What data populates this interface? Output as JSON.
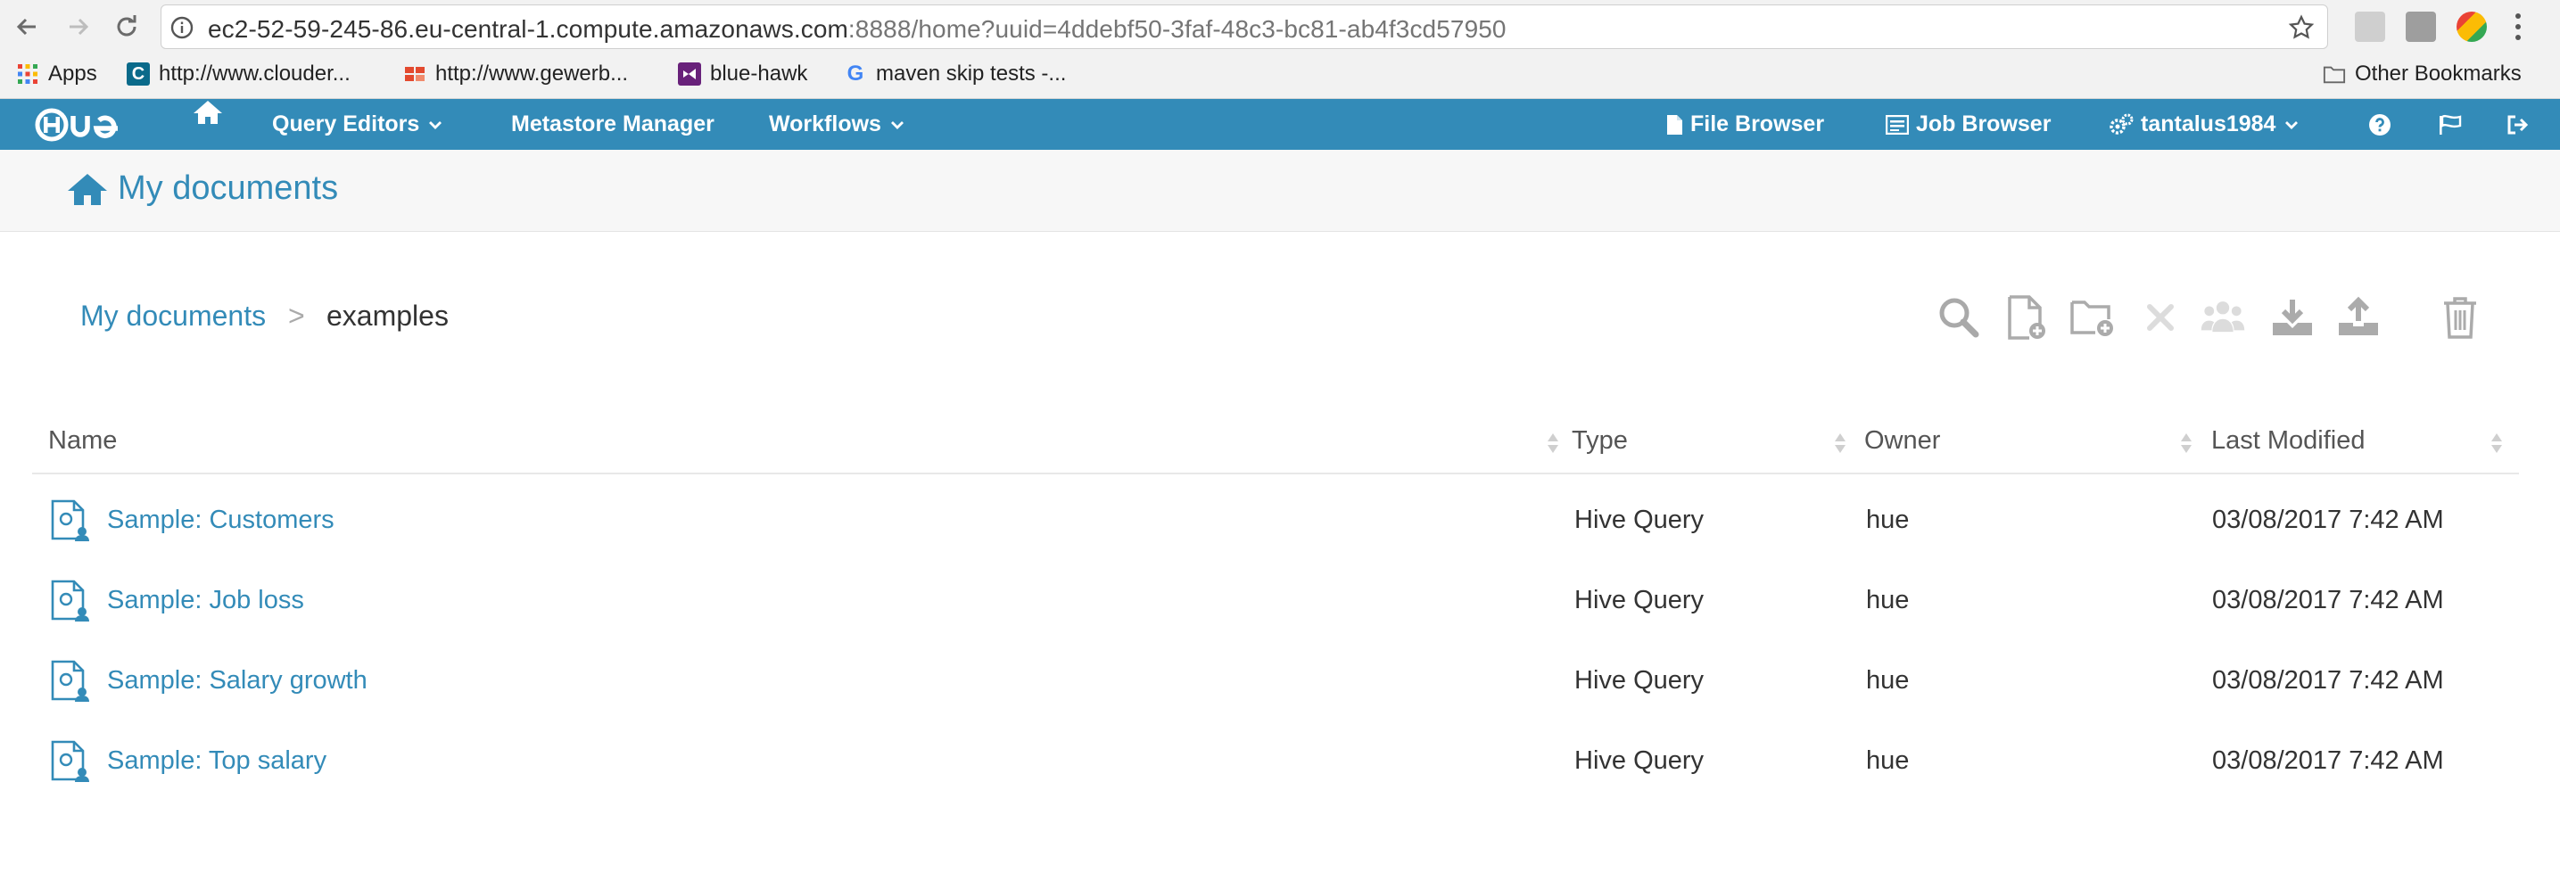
{
  "browser": {
    "url_host": "ec2-52-59-245-86.eu-central-1.compute.amazonaws.com",
    "url_rest": ":8888/home?uuid=4ddebf50-3faf-48c3-bc81-ab4f3cd57950",
    "bookmarks": [
      {
        "label": "Apps",
        "icon": "apps-grid-icon"
      },
      {
        "label": "http://www.clouder...",
        "icon": "cloudera-icon"
      },
      {
        "label": "http://www.gewerb...",
        "icon": "gewerbe-icon"
      },
      {
        "label": "blue-hawk",
        "icon": "visual-studio-icon"
      },
      {
        "label": "maven skip tests -...",
        "icon": "google-icon"
      }
    ],
    "other_bookmarks": "Other Bookmarks"
  },
  "hue_nav": {
    "logo": "HUE",
    "query_editors": "Query Editors",
    "metastore": "Metastore Manager",
    "workflows": "Workflows",
    "file_browser": "File Browser",
    "job_browser": "Job Browser",
    "user": "tantalus1984"
  },
  "page": {
    "title": "My documents"
  },
  "breadcrumb": {
    "root": "My documents",
    "separator": ">",
    "current": "examples"
  },
  "table": {
    "headers": {
      "name": "Name",
      "type": "Type",
      "owner": "Owner",
      "modified": "Last Modified"
    },
    "rows": [
      {
        "name": "Sample: Customers",
        "type": "Hive Query",
        "owner": "hue",
        "modified": "03/08/2017 7:42 AM"
      },
      {
        "name": "Sample: Job loss",
        "type": "Hive Query",
        "owner": "hue",
        "modified": "03/08/2017 7:42 AM"
      },
      {
        "name": "Sample: Salary growth",
        "type": "Hive Query",
        "owner": "hue",
        "modified": "03/08/2017 7:42 AM"
      },
      {
        "name": "Sample: Top salary",
        "type": "Hive Query",
        "owner": "hue",
        "modified": "03/08/2017 7:42 AM"
      }
    ]
  },
  "colors": {
    "hue_blue": "#338bb8",
    "toolbar_gray": "#b5b5b5",
    "toolbar_disabled": "#dcdcdc"
  }
}
